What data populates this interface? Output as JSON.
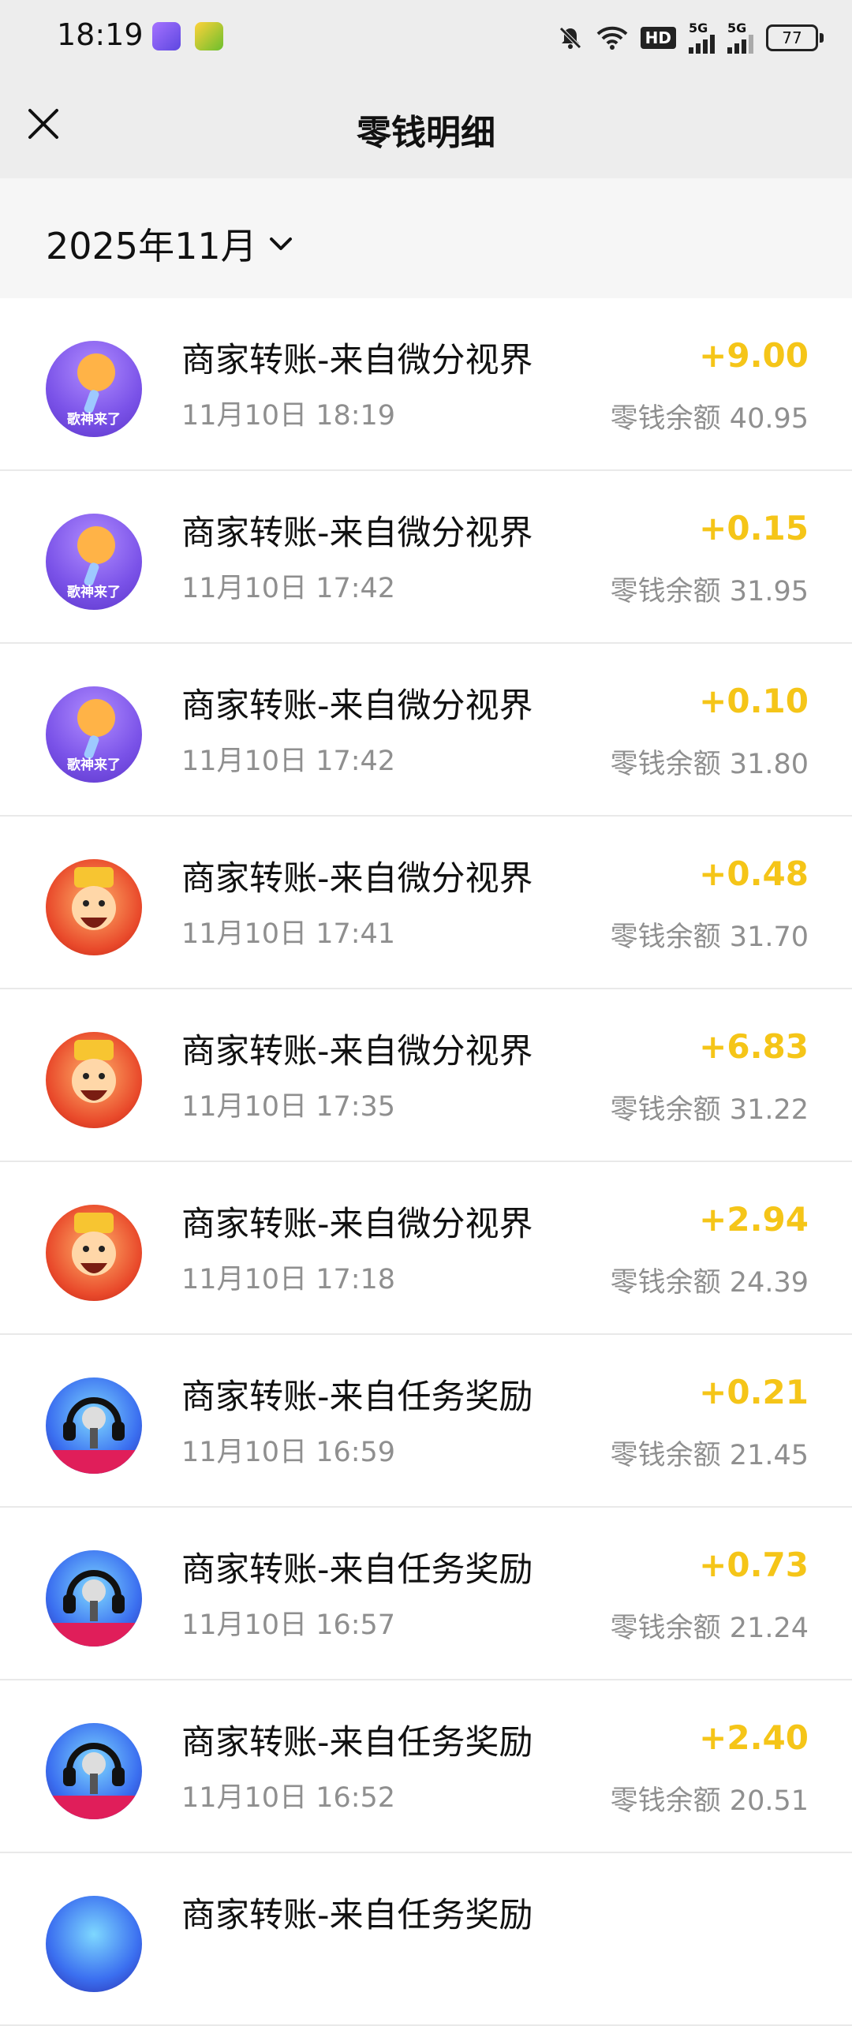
{
  "status_bar": {
    "time": "18:19",
    "hd": "HD",
    "net1": "5G",
    "net2": "5G",
    "battery": "77"
  },
  "header": {
    "title": "零钱明细"
  },
  "filter": {
    "month": "2025年11月"
  },
  "transactions": [
    {
      "title": "商家转账-来自微分视界",
      "time": "11月10日 18:19",
      "amount": "+9.00",
      "balance": "零钱余额 40.95",
      "icon": "singer-app-icon",
      "avatar_text": "歌神来了"
    },
    {
      "title": "商家转账-来自微分视界",
      "time": "11月10日 17:42",
      "amount": "+0.15",
      "balance": "零钱余额 31.95",
      "icon": "singer-app-icon",
      "avatar_text": "歌神来了"
    },
    {
      "title": "商家转账-来自微分视界",
      "time": "11月10日 17:42",
      "amount": "+0.10",
      "balance": "零钱余额 31.80",
      "icon": "singer-app-icon",
      "avatar_text": "歌神来了"
    },
    {
      "title": "商家转账-来自微分视界",
      "time": "11月10日 17:41",
      "amount": "+0.48",
      "balance": "零钱余额 31.70",
      "icon": "fortune-god-icon"
    },
    {
      "title": "商家转账-来自微分视界",
      "time": "11月10日 17:35",
      "amount": "+6.83",
      "balance": "零钱余额 31.22",
      "icon": "fortune-god-icon"
    },
    {
      "title": "商家转账-来自微分视界",
      "time": "11月10日 17:18",
      "amount": "+2.94",
      "balance": "零钱余额 24.39",
      "icon": "fortune-god-icon"
    },
    {
      "title": "商家转账-来自任务奖励",
      "time": "11月10日 16:59",
      "amount": "+0.21",
      "balance": "零钱余额 21.45",
      "icon": "microphone-app-icon"
    },
    {
      "title": "商家转账-来自任务奖励",
      "time": "11月10日 16:57",
      "amount": "+0.73",
      "balance": "零钱余额 21.24",
      "icon": "microphone-app-icon"
    },
    {
      "title": "商家转账-来自任务奖励",
      "time": "11月10日 16:52",
      "amount": "+2.40",
      "balance": "零钱余额 20.51",
      "icon": "microphone-app-icon"
    },
    {
      "title": "商家转账-来自任务奖励",
      "time": "",
      "amount": "",
      "balance": "",
      "icon": "microphone-app-icon"
    }
  ],
  "colors": {
    "amount": "#f5c518",
    "header_bg": "#ededed",
    "month_bg": "#f6f6f6"
  }
}
